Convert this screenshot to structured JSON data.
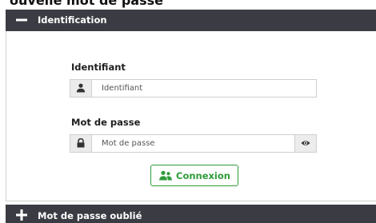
{
  "top_fragment": "ouvelle mot de passe",
  "panel": {
    "title": "Identification",
    "header_icon": "minus-icon"
  },
  "identifier": {
    "label": "Identifiant",
    "placeholder": "Identifiant",
    "icon": "user-icon"
  },
  "password": {
    "label": "Mot de passe",
    "placeholder": "Mot de passe",
    "icon": "lock-icon",
    "toggle_icon": "eye-icon"
  },
  "login_button": {
    "label": "Connexion",
    "icon": "users-icon",
    "color": "#2f9c3a"
  },
  "footer": {
    "title": "Mot de passe oublié",
    "icon": "plus-icon"
  },
  "colors": {
    "header_bg": "#3b3c43",
    "addon_bg": "#ececec",
    "accent": "#2f9c3a"
  }
}
